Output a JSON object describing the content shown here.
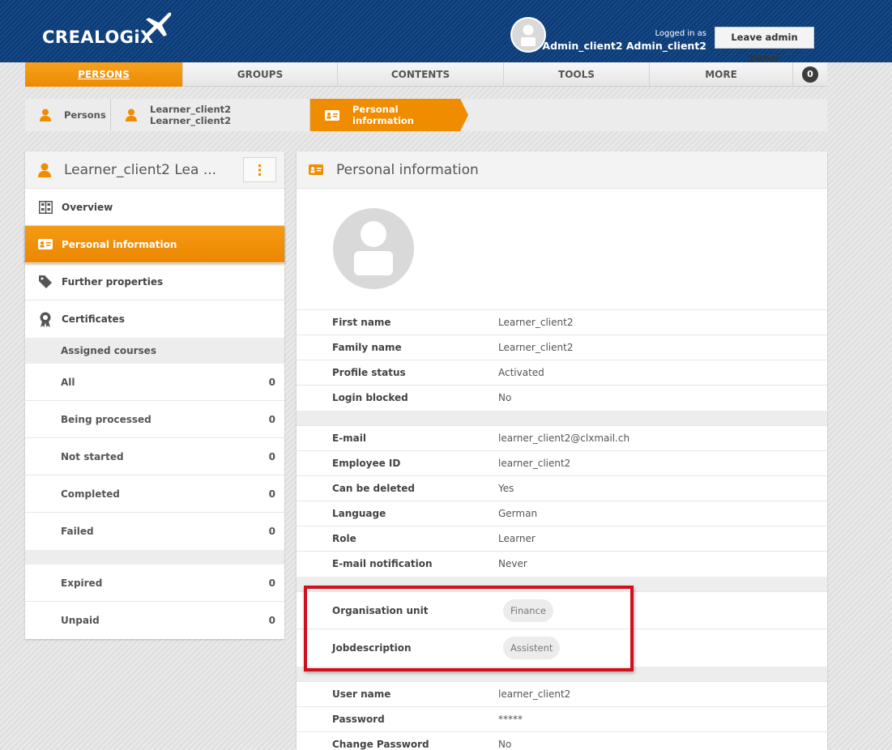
{
  "header": {
    "logo_text": "CREALOGiX",
    "logged_in_label": "Logged in as",
    "user_name": "Admin_client2 Admin_client2",
    "leave_button": "Leave admin panel",
    "brand_color": "#0f3f78",
    "accent_color": "#f08c00"
  },
  "nav": {
    "items": [
      "PERSONS",
      "GROUPS",
      "CONTENTS",
      "TOOLS",
      "MORE"
    ],
    "active": "PERSONS",
    "badge_count": "0"
  },
  "breadcrumb": {
    "items": [
      "Persons",
      "Learner_client2 Learner_client2",
      "Personal information"
    ]
  },
  "left_panel": {
    "title": "Learner_client2 Lea ...",
    "menu_icon": "vertical-dots-icon",
    "items": [
      {
        "label": "Overview",
        "icon": "grid-icon"
      },
      {
        "label": "Personal information",
        "icon": "id-card-icon"
      },
      {
        "label": "Further properties",
        "icon": "tag-icon"
      },
      {
        "label": "Certificates",
        "icon": "badge-icon"
      }
    ],
    "assigned_courses_label": "Assigned courses",
    "courses": [
      {
        "label": "All",
        "count": "0"
      },
      {
        "label": "Being processed",
        "count": "0"
      },
      {
        "label": "Not started",
        "count": "0"
      },
      {
        "label": "Completed",
        "count": "0"
      },
      {
        "label": "Failed",
        "count": "0"
      }
    ],
    "other_courses": [
      {
        "label": "Expired",
        "count": "0"
      },
      {
        "label": "Unpaid",
        "count": "0"
      }
    ]
  },
  "right_panel": {
    "title": "Personal information",
    "group1": [
      {
        "label": "First name",
        "value": "Learner_client2"
      },
      {
        "label": "Family name",
        "value": "Learner_client2"
      },
      {
        "label": "Profile status",
        "value": "Activated"
      },
      {
        "label": "Login blocked",
        "value": "No"
      }
    ],
    "group2": [
      {
        "label": "E-mail",
        "value": "learner_client2@clxmail.ch"
      },
      {
        "label": "Employee ID",
        "value": "learner_client2"
      },
      {
        "label": "Can be deleted",
        "value": "Yes"
      },
      {
        "label": "Language",
        "value": "German"
      },
      {
        "label": "Role",
        "value": "Learner"
      },
      {
        "label": "E-mail notification",
        "value": "Never"
      }
    ],
    "group3": [
      {
        "label": "Organisation unit",
        "tag": "Finance"
      },
      {
        "label": "Jobdescription",
        "tag": "Assistent"
      }
    ],
    "group4": [
      {
        "label": "User name",
        "value": "learner_client2"
      },
      {
        "label": "Password",
        "value": "*****"
      },
      {
        "label": "Change Password",
        "value": "No"
      }
    ],
    "highlight_color": "#d0101e"
  }
}
